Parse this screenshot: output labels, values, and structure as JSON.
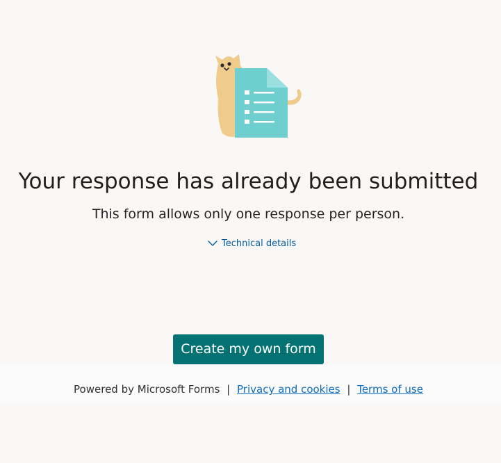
{
  "illustration": {
    "icon": "cat-with-form-illustration"
  },
  "message": {
    "title": "Your response has already been submitted",
    "subtitle": "This form allows only one response per person.",
    "details_toggle": "Technical details"
  },
  "actions": {
    "create_form_label": "Create my own form"
  },
  "footer": {
    "powered_by": "Powered by Microsoft Forms",
    "separator": "|",
    "privacy_link": "Privacy and cookies",
    "terms_link": "Terms of use"
  },
  "colors": {
    "background": "#faf8f7",
    "accent": "#047272",
    "link": "#0f6cbd"
  }
}
